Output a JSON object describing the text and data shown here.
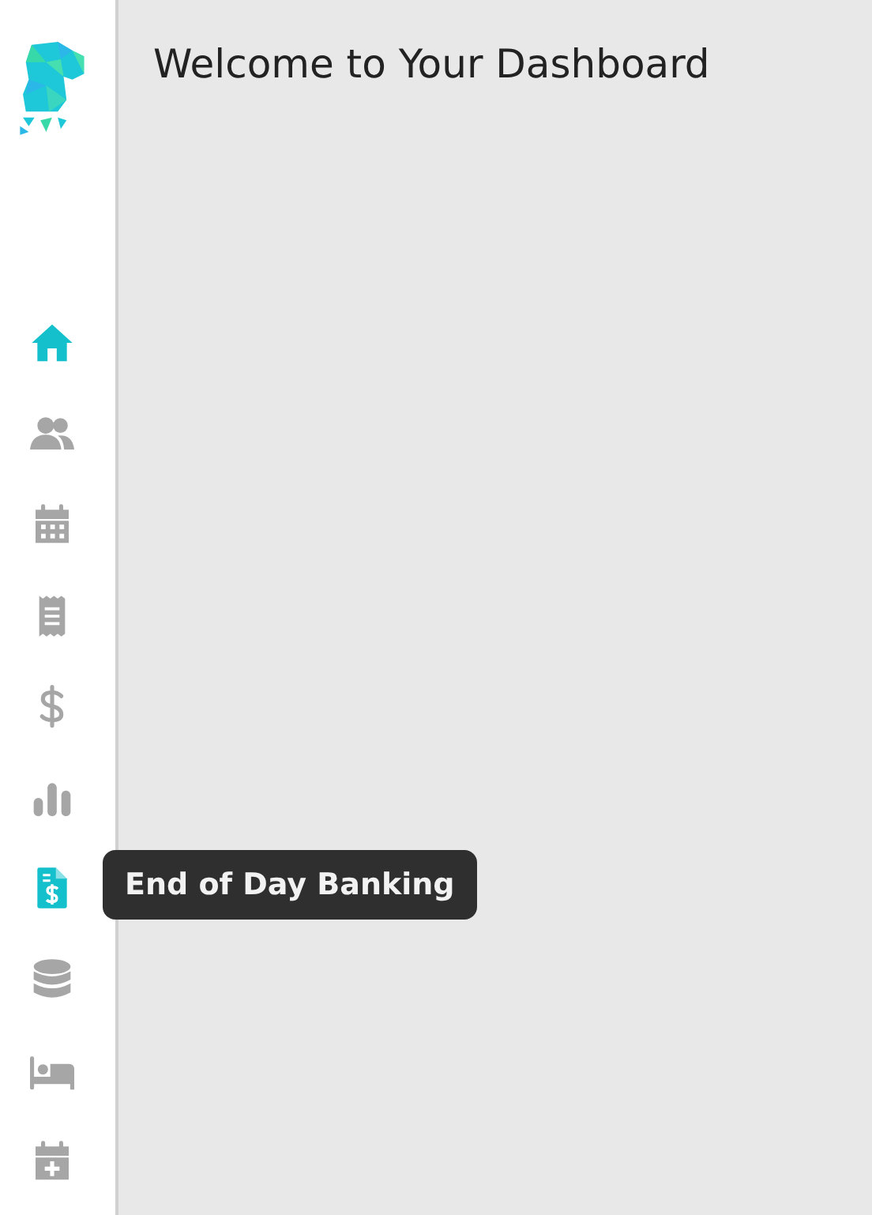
{
  "sidebar": {
    "items": [
      {
        "kind": "home",
        "selected": true
      },
      {
        "kind": "people",
        "selected": false
      },
      {
        "kind": "calendar",
        "selected": false
      },
      {
        "kind": "receipt",
        "selected": false
      },
      {
        "kind": "dollar",
        "selected": false
      },
      {
        "kind": "chart",
        "selected": false
      },
      {
        "kind": "invoice",
        "selected": true,
        "tooltip": "End of Day Banking"
      },
      {
        "kind": "database",
        "selected": false
      },
      {
        "kind": "bed",
        "selected": false
      },
      {
        "kind": "calendar-plus",
        "selected": false
      }
    ]
  },
  "main": {
    "title": "Welcome to Your Dashboard"
  }
}
